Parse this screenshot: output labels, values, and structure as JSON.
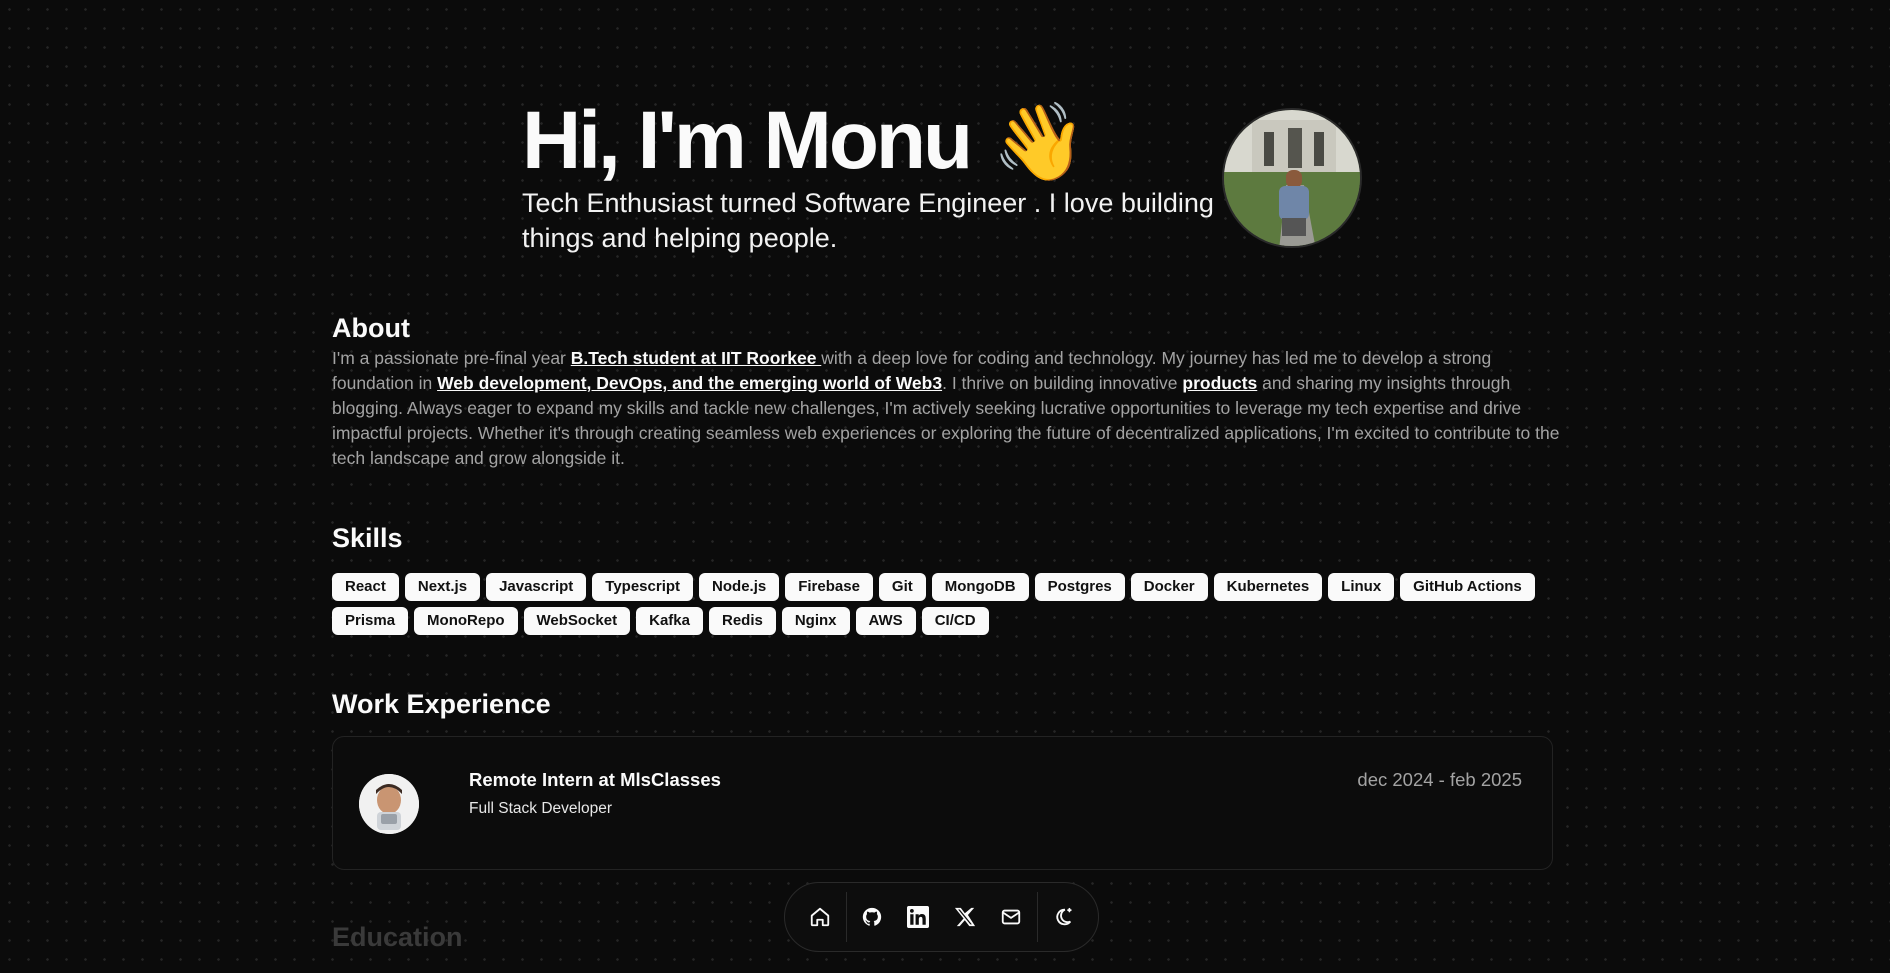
{
  "hero": {
    "greeting": "Hi, I'm Monu",
    "wave_emoji": "👋",
    "subtitle": "Tech Enthusiast turned Software Engineer . I love building things and helping people."
  },
  "about": {
    "title": "About",
    "t1": "I'm a passionate pre-final year ",
    "l1": "B.Tech student at IIT Roorkee ",
    "t2": "with a deep love for coding and technology. My journey has led me to develop a strong foundation in ",
    "l2": "Web development, DevOps, and the emerging world of Web3",
    "t3": ". I thrive on building innovative ",
    "l3": "products",
    "t4": " and sharing my insights through blogging. Always eager to expand my skills and tackle new challenges, I'm actively seeking lucrative opportunities to leverage my tech expertise and drive impactful projects. Whether it's through creating seamless web experiences or exploring the future of decentralized applications, I'm excited to contribute to the tech landscape and grow alongside it."
  },
  "skills": {
    "title": "Skills",
    "items": [
      "React",
      "Next.js",
      "Javascript",
      "Typescript",
      "Node.js",
      "Firebase",
      "Git",
      "MongoDB",
      "Postgres",
      "Docker",
      "Kubernetes",
      "Linux",
      "GitHub Actions",
      "Prisma",
      "MonoRepo",
      "WebSocket",
      "Kafka",
      "Redis",
      "Nginx",
      "AWS",
      "CI/CD"
    ]
  },
  "work": {
    "title": "Work Experience",
    "jobs": [
      {
        "title": "Remote Intern at MlsClasses",
        "role": "Full Stack Developer",
        "dates": "dec 2024 - feb 2025"
      }
    ]
  },
  "education": {
    "title": "Education"
  },
  "dock": {
    "items": [
      "home-icon",
      "github-icon",
      "linkedin-icon",
      "x-icon",
      "mail-icon",
      "theme-toggle-icon"
    ]
  }
}
